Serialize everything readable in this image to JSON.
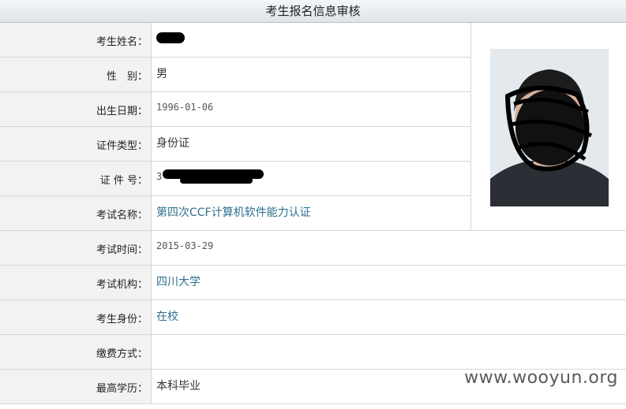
{
  "title": "考生报名信息审核",
  "rows": [
    {
      "label": "考生姓名：",
      "value": ""
    },
    {
      "label": "性　别：",
      "value": "男"
    },
    {
      "label": "出生日期：",
      "value": "1996-01-06"
    },
    {
      "label": "证件类型：",
      "value": "身份证"
    },
    {
      "label": "证 件 号：",
      "value": "3"
    },
    {
      "label": "考试名称：",
      "value": "第四次CCF计算机软件能力认证"
    },
    {
      "label": "考试时间：",
      "value": "2015-03-29"
    },
    {
      "label": "考试机构：",
      "value": "四川大学"
    },
    {
      "label": "考生身份：",
      "value": "在校"
    },
    {
      "label": "缴费方式：",
      "value": ""
    },
    {
      "label": "最高学历：",
      "value": "本科毕业"
    }
  ],
  "watermark": "www.wooyun.org"
}
